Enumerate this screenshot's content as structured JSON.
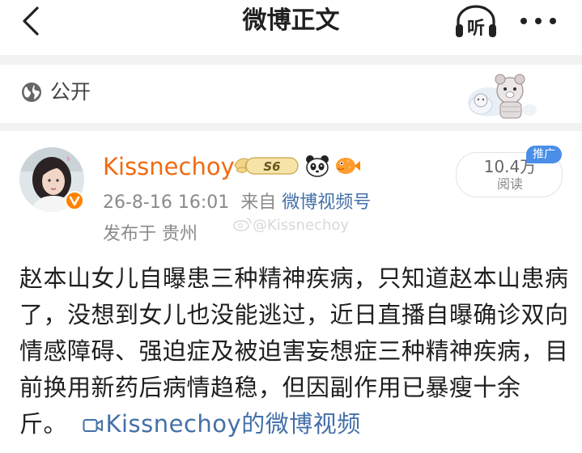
{
  "nav": {
    "title": "微博正文",
    "listen_label": "听",
    "icons": {
      "back": "chevron-left-icon",
      "listen": "headphones-icon",
      "more": "more-dots-icon"
    }
  },
  "visibility": {
    "label": "公开",
    "icon": "globe-icon"
  },
  "author": {
    "name": "Kissnechoy",
    "level_badge": "S6",
    "badges": [
      "gold-wing-badge",
      "panda-badge",
      "pufferfish-badge"
    ],
    "verified_icon": "verified-v-badge",
    "name_color": "#f06a11"
  },
  "meta": {
    "timestamp": "26-8-16 16:01",
    "source_prefix": "来自",
    "source": "微博视频号",
    "location": "发布于 贵州"
  },
  "watermark": "@Kissnechoy",
  "stats": {
    "read_count": "10.4万",
    "read_label": "阅读",
    "promo_label": "推广"
  },
  "post": {
    "text": "赵本山女儿自曝患三种精神疾病，只知道赵本山患病了，没想到女儿也没能逃过，近日直播自曝确诊双向情感障碍、强迫症及被迫害妄想症三种精神疾病，目前换用新药后病情趋稳，但因副作用已暴瘦十余斤。",
    "video_link_label": "Kissnechoy的微博视频"
  },
  "colors": {
    "link": "#4470a8",
    "accent_orange": "#ff8200",
    "promo_blue": "#4a8ee8",
    "divider": "#f2f2f2"
  }
}
